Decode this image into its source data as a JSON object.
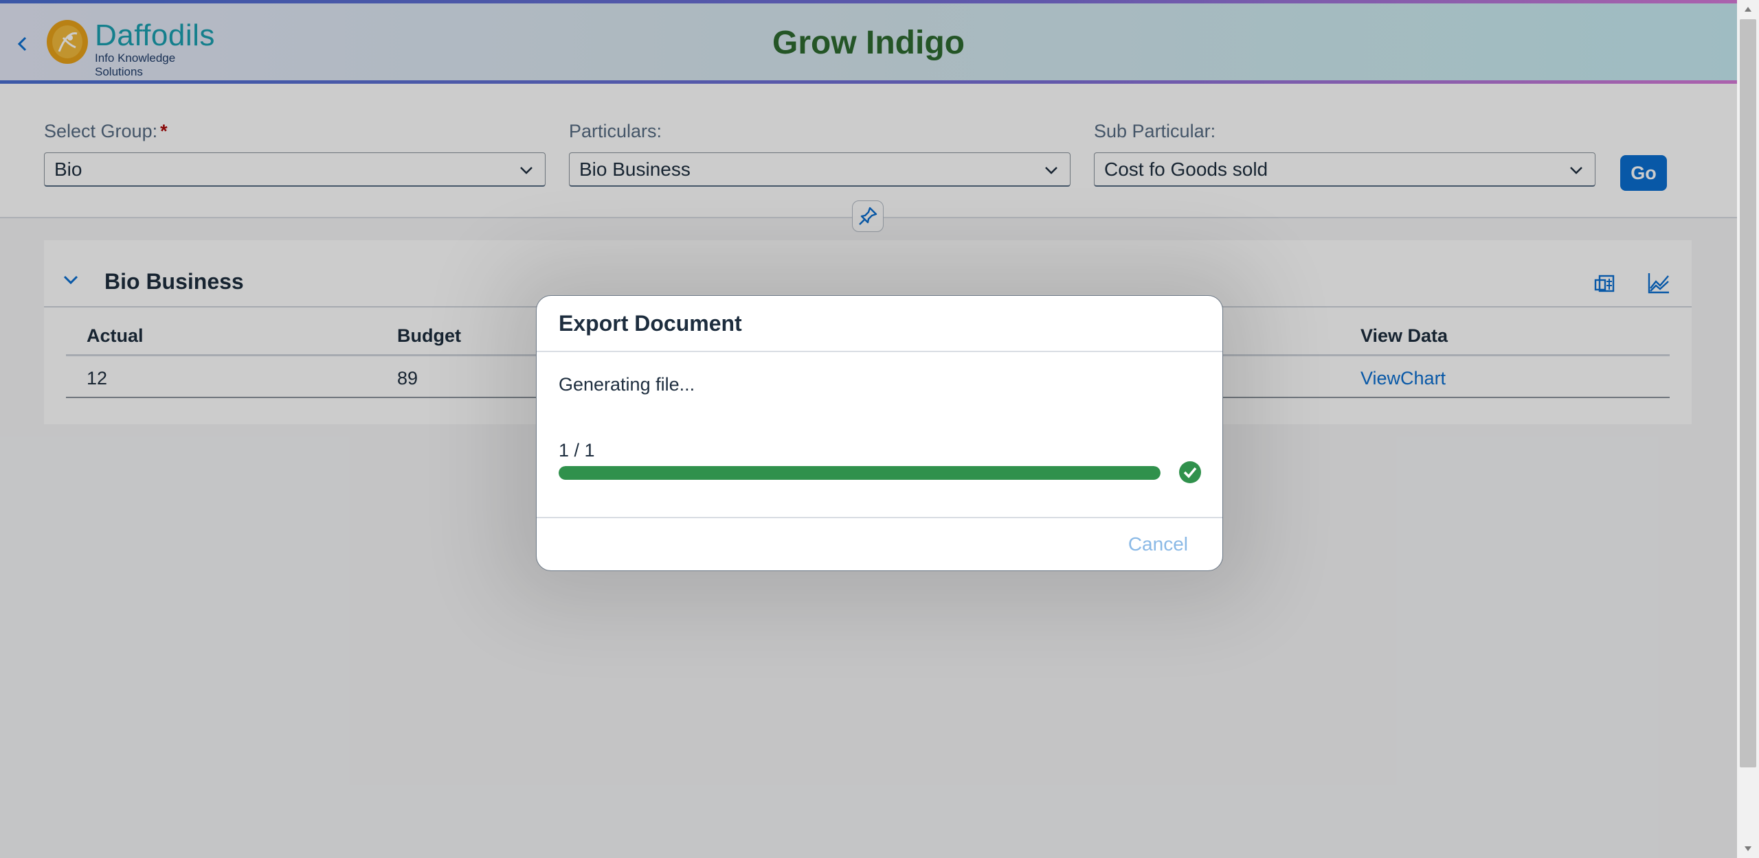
{
  "header": {
    "back_label": "Back",
    "logo_name": "Daffodils",
    "logo_tagline": "Info Knowledge Solutions",
    "title": "Grow Indigo"
  },
  "filters": {
    "group": {
      "label": "Select Group:",
      "required_mark": "*",
      "value": "Bio"
    },
    "particulars": {
      "label": "Particulars:",
      "value": "Bio Business"
    },
    "sub_particular": {
      "label": "Sub Particular:",
      "value": "Cost fo Goods sold"
    },
    "go_label": "Go"
  },
  "panel": {
    "title": "Bio Business",
    "columns": [
      "Actual",
      "Budget",
      "View Data"
    ],
    "rows": [
      {
        "actual": "12",
        "budget": "89",
        "view_data": "ViewChart"
      }
    ]
  },
  "dialog": {
    "title": "Export Document",
    "message": "Generating file...",
    "progress_text": "1 / 1",
    "progress_fraction": 1.0,
    "cancel_label": "Cancel"
  },
  "colors": {
    "accent": "#0a6ed1",
    "title_green": "#2e6b30",
    "progress_green": "#30914c"
  }
}
